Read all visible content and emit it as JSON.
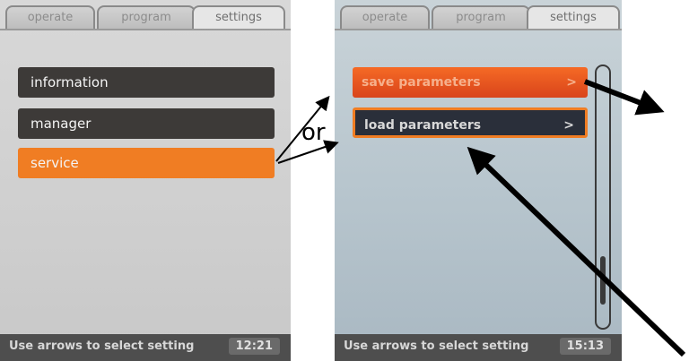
{
  "left_screen": {
    "tabs": [
      "operate",
      "program",
      "settings"
    ],
    "menu": [
      "information",
      "manager",
      "service"
    ],
    "status_msg": "Use arrows to select setting",
    "status_time": "12:21"
  },
  "right_screen": {
    "tabs": [
      "operate",
      "program",
      "settings"
    ],
    "menu": [
      "save parameters",
      "load parameters"
    ],
    "chevron": ">",
    "status_msg": "Use arrows to select setting",
    "status_time": "15:13"
  },
  "annotation": {
    "or_text": "or"
  },
  "colors": {
    "orange": "#f07d23",
    "dark": "#3d3a38",
    "status": "#4e4e4e"
  }
}
